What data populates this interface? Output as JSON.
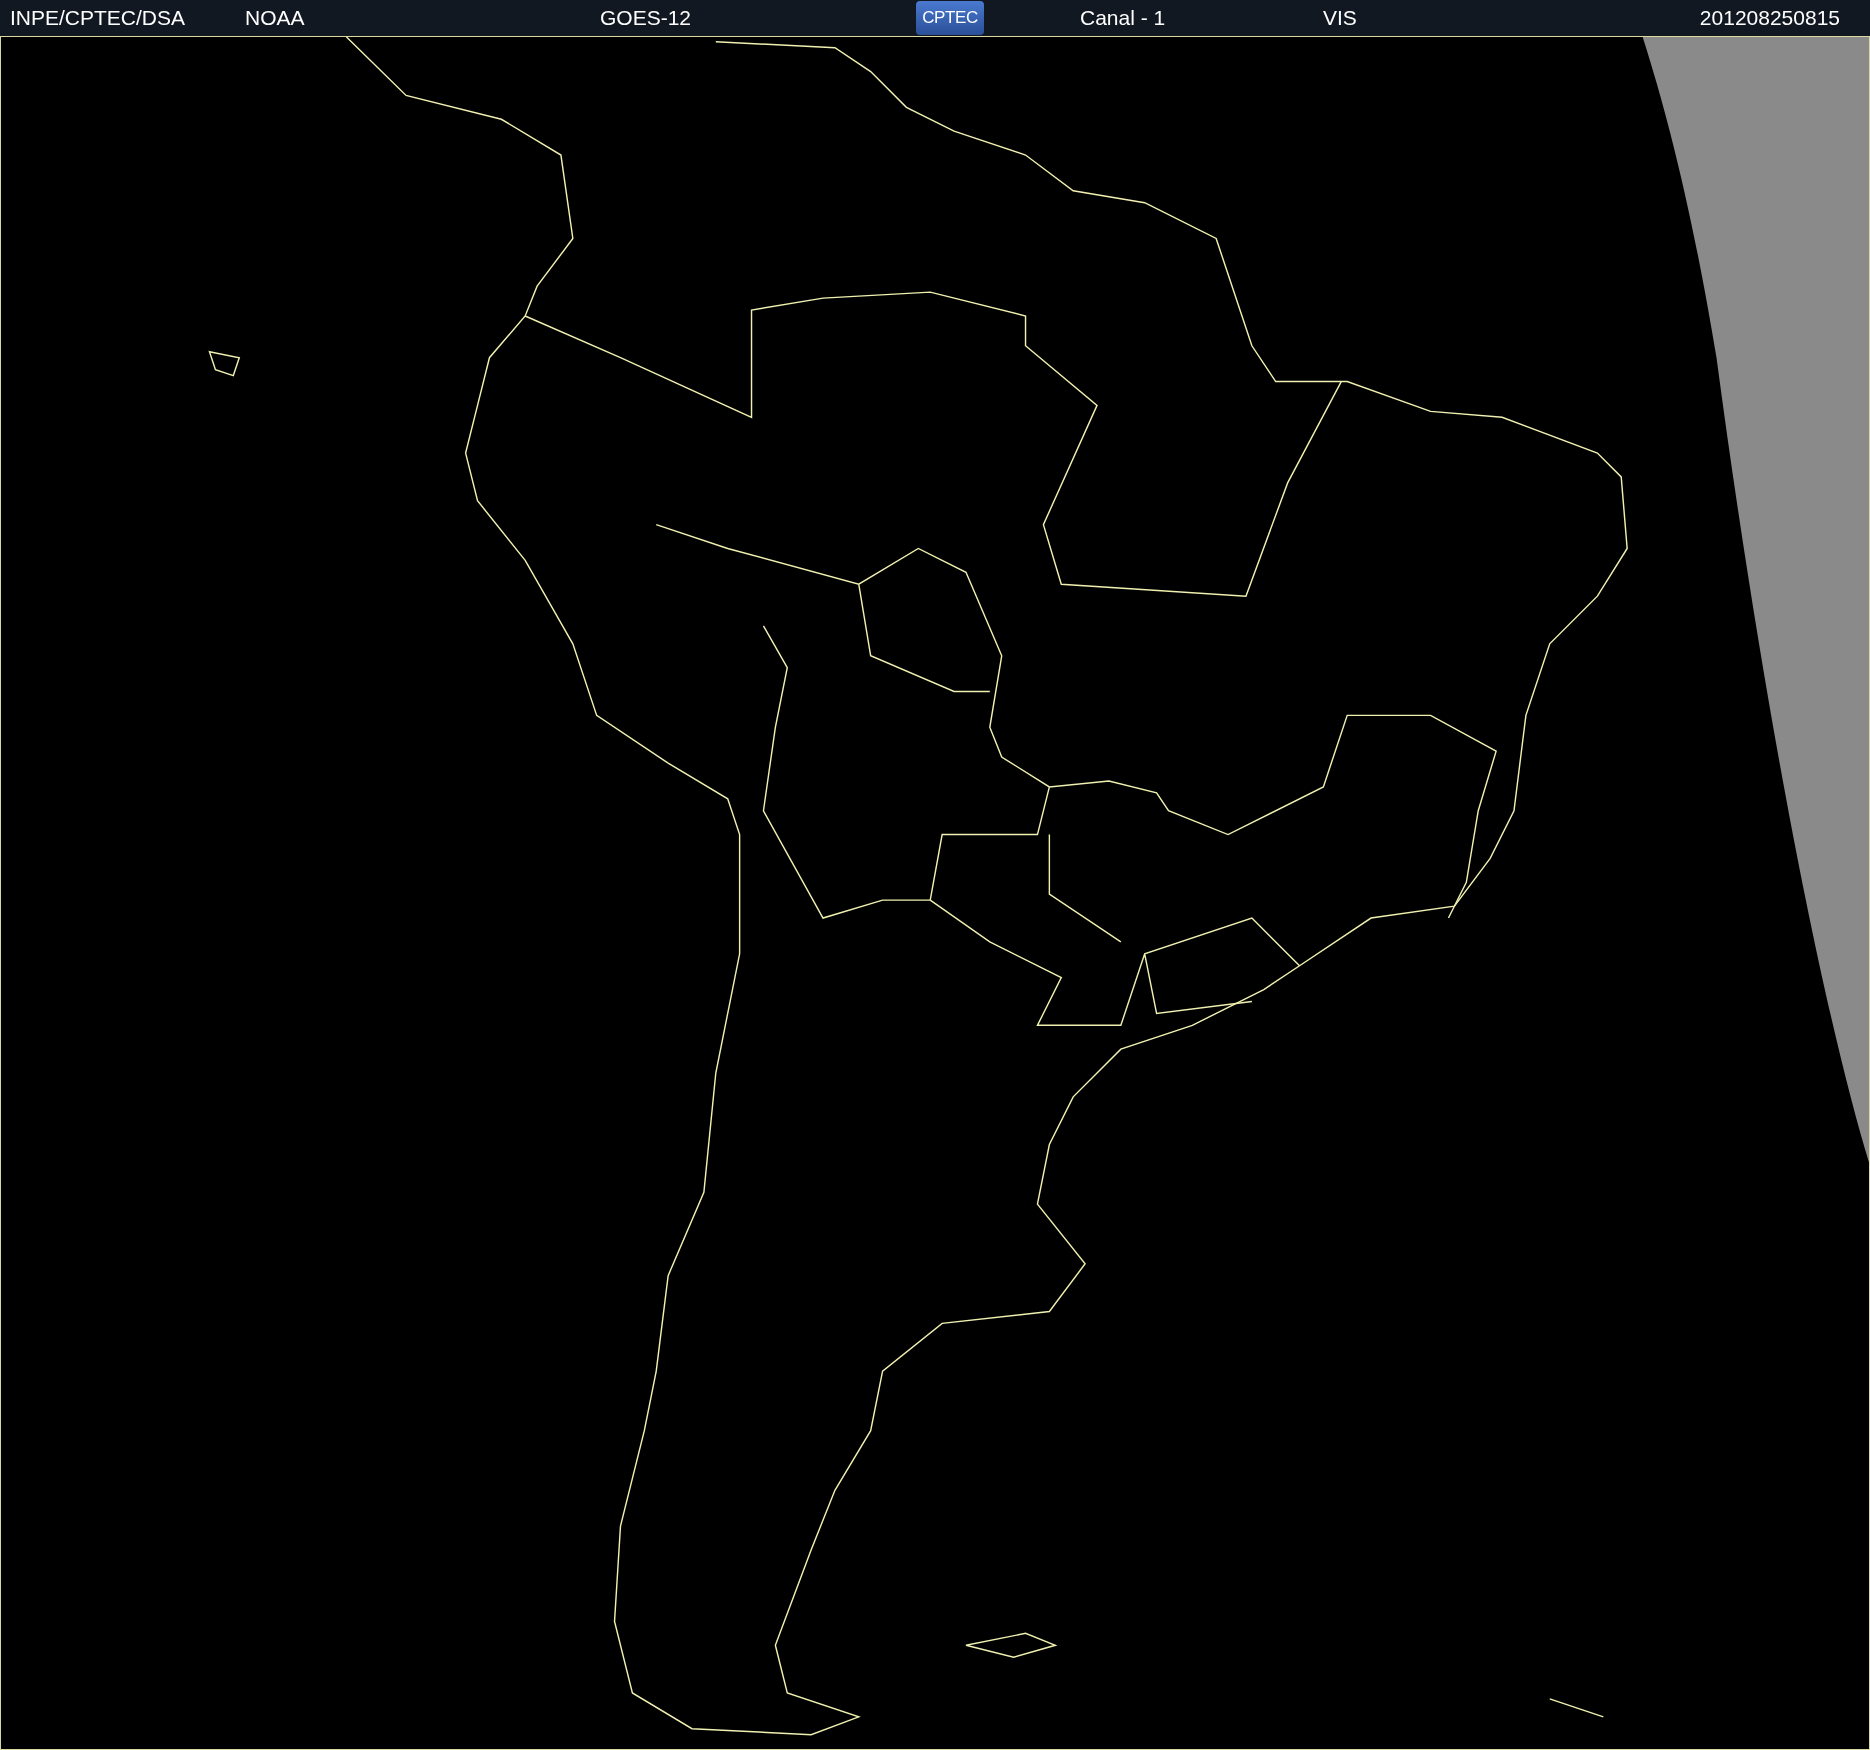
{
  "header": {
    "items": [
      {
        "kind": "text",
        "label": "INPE/CPTEC/DSA"
      },
      {
        "kind": "text",
        "label": "NOAA"
      },
      {
        "kind": "text",
        "label": "GOES-12"
      },
      {
        "kind": "logo",
        "label": "CPTEC"
      },
      {
        "kind": "text",
        "label": "Canal - 1"
      },
      {
        "kind": "text",
        "label": "VIS"
      },
      {
        "kind": "text",
        "label": "201208250815"
      }
    ]
  }
}
